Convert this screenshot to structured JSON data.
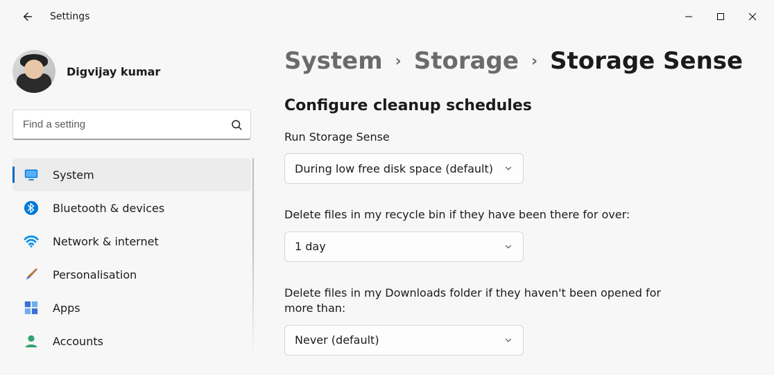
{
  "app_title": "Settings",
  "window_controls": {
    "min": "Minimize",
    "max": "Maximize",
    "close": "Close"
  },
  "profile": {
    "name": "Digvijay kumar"
  },
  "search": {
    "placeholder": "Find a setting"
  },
  "sidebar": {
    "items": [
      {
        "id": "system",
        "label": "System",
        "active": true
      },
      {
        "id": "bluetooth",
        "label": "Bluetooth & devices"
      },
      {
        "id": "network",
        "label": "Network & internet"
      },
      {
        "id": "personalisation",
        "label": "Personalisation"
      },
      {
        "id": "apps",
        "label": "Apps"
      },
      {
        "id": "accounts",
        "label": "Accounts"
      }
    ]
  },
  "breadcrumb": {
    "parts": [
      "System",
      "Storage",
      "Storage Sense"
    ]
  },
  "main": {
    "section_title": "Configure cleanup schedules",
    "run_label": "Run Storage Sense",
    "run_value": "During low free disk space (default)",
    "recycle_label": "Delete files in my recycle bin if they have been there for over:",
    "recycle_value": "1 day",
    "downloads_label": "Delete files in my Downloads folder if they haven't been opened for more than:",
    "downloads_value": "Never (default)"
  }
}
